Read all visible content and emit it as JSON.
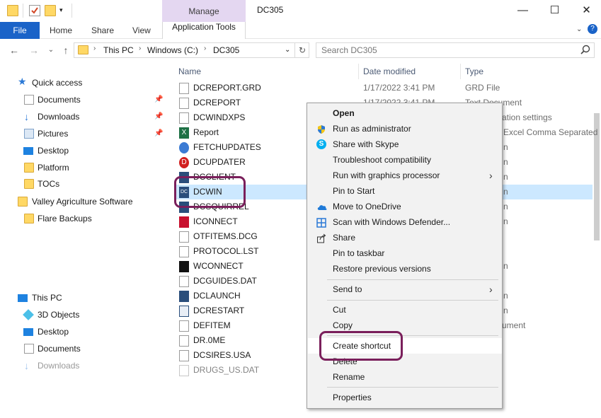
{
  "window": {
    "title": "DC305",
    "manage_label": "Manage"
  },
  "ribbon": {
    "tabs": [
      "File",
      "Home",
      "Share",
      "View",
      "Application Tools"
    ]
  },
  "address": {
    "crumbs": [
      "This PC",
      "Windows (C:)",
      "DC305"
    ],
    "search_placeholder": "Search DC305"
  },
  "sidebar": {
    "quick_access": "Quick access",
    "items": [
      {
        "label": "Documents"
      },
      {
        "label": "Downloads"
      },
      {
        "label": "Pictures"
      },
      {
        "label": "Desktop"
      },
      {
        "label": "Platform"
      },
      {
        "label": "TOCs"
      },
      {
        "label": "Valley Agriculture Software"
      },
      {
        "label": "Flare Backups"
      },
      {
        "label": "This PC"
      },
      {
        "label": "3D Objects"
      },
      {
        "label": "Desktop"
      },
      {
        "label": "Documents"
      },
      {
        "label": "Downloads"
      }
    ]
  },
  "columns": {
    "name": "Name",
    "date": "Date modified",
    "type": "Type"
  },
  "files": [
    {
      "name": "DCREPORT.GRD",
      "date": "1/17/2022 3:41 PM",
      "type": "GRD File"
    },
    {
      "name": "DCREPORT",
      "date": "1/17/2022 3:41 PM",
      "type": "Text Document"
    },
    {
      "name": "DCWINDXPS",
      "date": "",
      "type": "ation settings"
    },
    {
      "name": "Report",
      "date": "",
      "type": "Excel Comma Separated"
    },
    {
      "name": "FETCHUPDATES",
      "date": "",
      "type": "n"
    },
    {
      "name": "DCUPDATER",
      "date": "",
      "type": "n"
    },
    {
      "name": "DCCLIENT",
      "date": "",
      "type": "n"
    },
    {
      "name": "DCWIN",
      "date": "",
      "type": "n"
    },
    {
      "name": "DCSQUIRREL",
      "date": "",
      "type": "n"
    },
    {
      "name": "ICONNECT",
      "date": "",
      "type": "n"
    },
    {
      "name": "OTFITEMS.DCG",
      "date": "",
      "type": ""
    },
    {
      "name": "PROTOCOL.LST",
      "date": "",
      "type": ""
    },
    {
      "name": "WCONNECT",
      "date": "",
      "type": "n"
    },
    {
      "name": "DCGUIDES.DAT",
      "date": "",
      "type": ""
    },
    {
      "name": "DCLAUNCH",
      "date": "",
      "type": "n"
    },
    {
      "name": "DCRESTART",
      "date": "",
      "type": "n"
    },
    {
      "name": "DEFITEM",
      "date": "",
      "type": "ument"
    },
    {
      "name": "DR.0ME",
      "date": "",
      "type": ""
    },
    {
      "name": "DCSIRES.USA",
      "date": "",
      "type": ""
    },
    {
      "name": "DRUGS_US.DAT",
      "date": "",
      "type": ""
    }
  ],
  "context_menu": {
    "items": [
      "Open",
      "Run as administrator",
      "Share with Skype",
      "Troubleshoot compatibility",
      "Run with graphics processor",
      "Pin to Start",
      "Move to OneDrive",
      "Scan with Windows Defender...",
      "Share",
      "Pin to taskbar",
      "Restore previous versions",
      "Send to",
      "Cut",
      "Copy",
      "Create shortcut",
      "Delete",
      "Rename",
      "Properties"
    ],
    "arrow": "›"
  },
  "colors": {
    "accent": "#1a63c8",
    "callout": "#7a1f5b",
    "manage": "#e4d7f1",
    "selection": "#cce8ff"
  }
}
